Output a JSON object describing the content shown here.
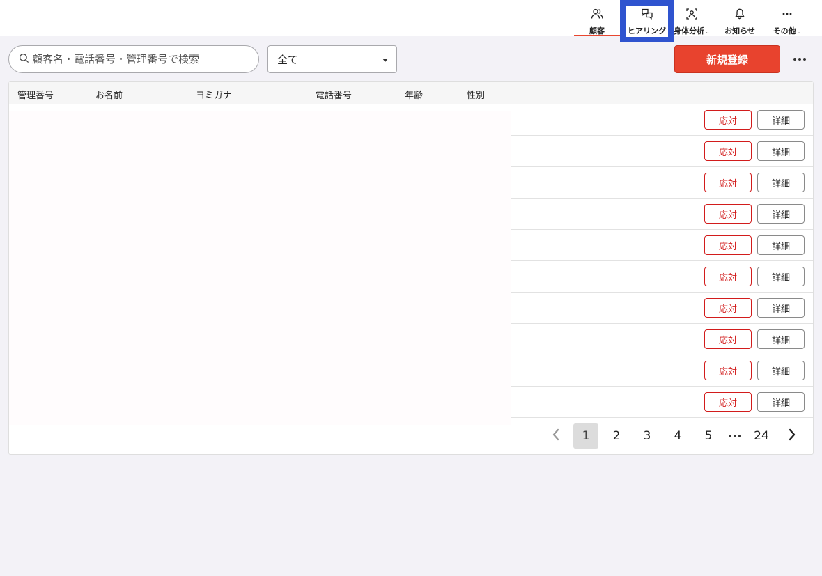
{
  "nav": {
    "items": [
      {
        "label": "顧客",
        "icon": "customers-icon"
      },
      {
        "label": "ヒアリング",
        "icon": "hearing-chat-icon"
      },
      {
        "label": "身体分析",
        "icon": "body-scan-icon",
        "dropdown": true
      },
      {
        "label": "お知らせ",
        "icon": "bell-icon"
      },
      {
        "label": "その他",
        "icon": "more-dots-icon",
        "dropdown": true
      }
    ],
    "active": "顧客",
    "highlight": "ヒアリング",
    "accent_color": "#e8462f",
    "highlight_color": "#2f54cf"
  },
  "toolbar": {
    "search_placeholder": "顧客名・電話番号・管理番号で検索",
    "filter_value": "全て",
    "new_button": "新規登録",
    "new_button_color": "#e8432e"
  },
  "table": {
    "columns": [
      "管理番号",
      "お名前",
      "ヨミガナ",
      "電話番号",
      "年齢",
      "性別"
    ],
    "rows": [
      {
        "respond": "応対",
        "detail": "詳細"
      },
      {
        "respond": "応対",
        "detail": "詳細"
      },
      {
        "respond": "応対",
        "detail": "詳細"
      },
      {
        "respond": "応対",
        "detail": "詳細"
      },
      {
        "respond": "応対",
        "detail": "詳細"
      },
      {
        "respond": "応対",
        "detail": "詳細"
      },
      {
        "respond": "応対",
        "detail": "詳細"
      },
      {
        "respond": "応対",
        "detail": "詳細"
      },
      {
        "respond": "応対",
        "detail": "詳細"
      },
      {
        "respond": "応対",
        "detail": "詳細"
      }
    ]
  },
  "pagination": {
    "pages": [
      "1",
      "2",
      "3",
      "4",
      "5"
    ],
    "last": "24",
    "current": "1"
  }
}
